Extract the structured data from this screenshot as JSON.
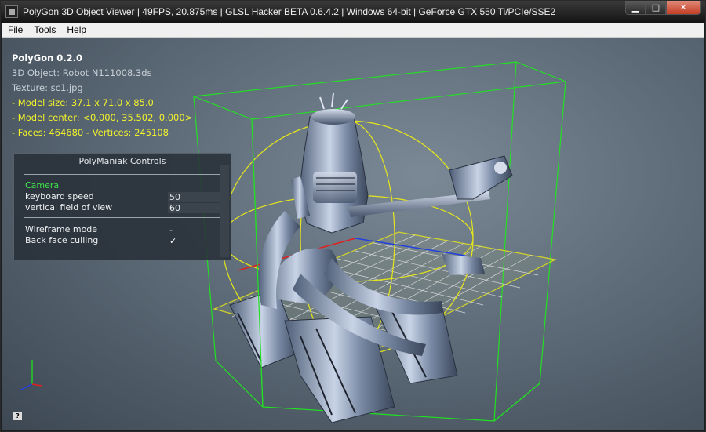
{
  "window": {
    "title": "PolyGon 3D Object Viewer | 49FPS, 20.875ms | GLSL Hacker BETA 0.6.4.2 | Windows 64-bit | GeForce GTX 550 Ti/PCIe/SSE2",
    "app_icon": "app-icon",
    "min_glyph": "▁",
    "max_glyph": "□",
    "close_glyph": "✕"
  },
  "menu": {
    "items": [
      "File",
      "Tools",
      "Help"
    ]
  },
  "hud": {
    "app_name": "PolyGon 0.2.0",
    "object": "3D Object: Robot N111008.3ds",
    "texture": "Texture: sc1.jpg",
    "model_size": "- Model size:  37.1 x 71.0 x 85.0",
    "model_center": "- Model center:  <0.000, 35.502, 0.000>",
    "faces_vertices": "- Faces: 464680 - Vertices: 245108"
  },
  "controls": {
    "title": "PolyManiak Controls",
    "camera_section": "Camera",
    "keyboard_speed_label": "keyboard speed",
    "keyboard_speed_value": "50",
    "fov_label": "vertical field of view",
    "fov_value": "60",
    "wireframe_label": "Wireframe mode",
    "wireframe_value": "-",
    "backface_label": "Back face culling",
    "backface_value": "✓"
  },
  "help_glyph": "?",
  "colors": {
    "bbox": "#22e022",
    "sphere": "#e6e61a",
    "grid": "#e8e8e8",
    "axis_x": "#e02020",
    "axis_y": "#22d022",
    "axis_z": "#2040e0",
    "hud_yellow": "#f3f32a",
    "section_green": "#3fe04c"
  }
}
